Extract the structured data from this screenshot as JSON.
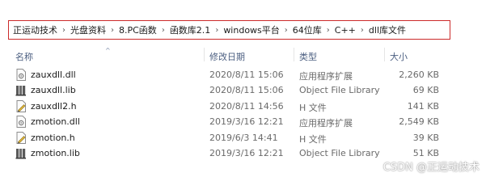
{
  "breadcrumb": {
    "items": [
      "正运动技术",
      "光盘资料",
      "8.PC函数",
      "函数库2.1",
      "windows平台",
      "64位库",
      "C++",
      "dll库文件"
    ],
    "separator": "›"
  },
  "columns": {
    "name": "名称",
    "date": "修改日期",
    "type": "类型",
    "size": "大小"
  },
  "files": [
    {
      "name": "zauxdll.dll",
      "date": "2020/8/11 15:06",
      "type": "应用程序扩展",
      "size": "2,260 KB",
      "icon": "dll-file-icon"
    },
    {
      "name": "zauxdll.lib",
      "date": "2020/8/11 15:06",
      "type": "Object File Library",
      "size": "69 KB",
      "icon": "lib-file-icon"
    },
    {
      "name": "zauxdll2.h",
      "date": "2020/8/11 14:56",
      "type": "H 文件",
      "size": "141 KB",
      "icon": "h-file-icon"
    },
    {
      "name": "zmotion.dll",
      "date": "2019/3/16 12:21",
      "type": "应用程序扩展",
      "size": "2,549 KB",
      "icon": "dll-file-icon"
    },
    {
      "name": "zmotion.h",
      "date": "2019/6/3 14:41",
      "type": "H 文件",
      "size": "39 KB",
      "icon": "h-file-icon"
    },
    {
      "name": "zmotion.lib",
      "date": "2019/3/16 12:21",
      "type": "Object File Library",
      "size": "51 KB",
      "icon": "lib-file-icon"
    }
  ],
  "watermark": "CSDN @正运动技术",
  "colors": {
    "highlight_border": "#cc2b2b",
    "header_text": "#4d6082"
  }
}
